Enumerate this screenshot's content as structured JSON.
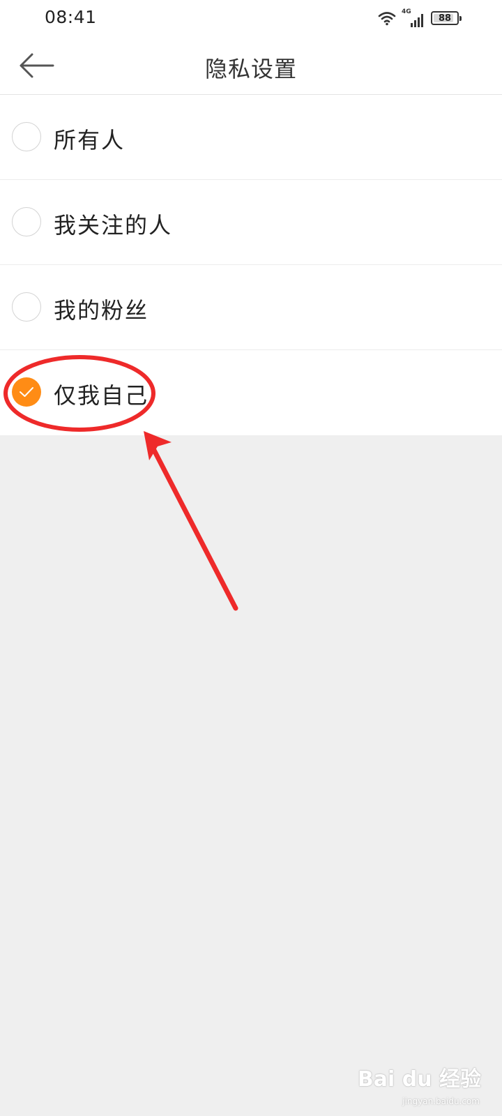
{
  "status_bar": {
    "time": "08:41",
    "network": "4G",
    "battery": "88",
    "battery_fraction": 0.88
  },
  "header": {
    "title": "隐私设置",
    "back_icon": "arrow-left-icon"
  },
  "options": [
    {
      "label": "所有人",
      "checked": false
    },
    {
      "label": "我关注的人",
      "checked": false
    },
    {
      "label": "我的粉丝",
      "checked": false
    },
    {
      "label": "仅我自己",
      "checked": true
    }
  ],
  "colors": {
    "accent": "#ff8c15",
    "annotation": "#ee2a2a",
    "background": "#efefef"
  },
  "watermark": {
    "text": "Bai du 经验",
    "sub": "jingyan.baidu.com"
  }
}
